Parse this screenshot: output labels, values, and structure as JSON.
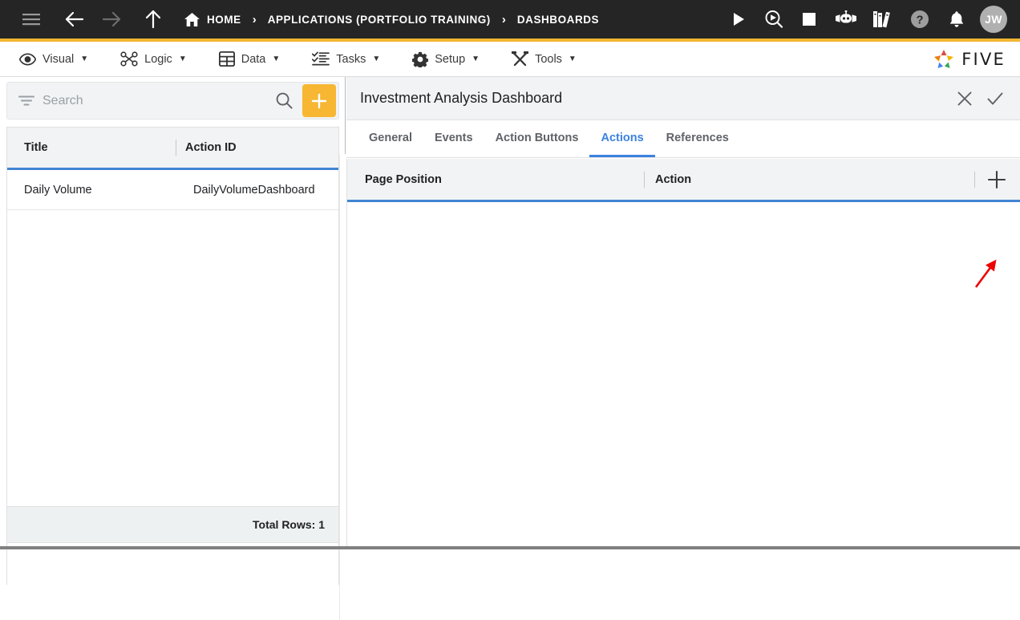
{
  "topbar": {
    "nav_icons": [
      {
        "name": "hamburger-menu-icon",
        "label": "Menu"
      },
      {
        "name": "back-arrow-icon",
        "label": "Back"
      },
      {
        "name": "forward-arrow-icon",
        "label": "Forward"
      },
      {
        "name": "up-arrow-icon",
        "label": "Up"
      }
    ],
    "breadcrumbs": [
      {
        "label": "HOME",
        "icon": "home-icon"
      },
      {
        "label": "APPLICATIONS (PORTFOLIO TRAINING)",
        "icon": ""
      },
      {
        "label": "DASHBOARDS",
        "icon": ""
      }
    ],
    "separator": "›",
    "right_icons": [
      {
        "name": "run-play-icon",
        "label": "Run"
      },
      {
        "name": "debug-search-play-icon",
        "label": "Debug"
      },
      {
        "name": "stop-square-icon",
        "label": "Stop"
      },
      {
        "name": "chat-bot-icon",
        "label": "Assistant"
      },
      {
        "name": "books-library-icon",
        "label": "Documentation"
      },
      {
        "name": "help-question-icon",
        "label": "Help"
      },
      {
        "name": "notification-bell-icon",
        "label": "Notifications"
      }
    ],
    "avatar_initials": "JW",
    "accent_bar_color": "#f2b632",
    "background_color": "#252525"
  },
  "menubar": {
    "items": [
      {
        "label": "Visual",
        "icon": "eye-icon",
        "caret": "▼"
      },
      {
        "label": "Logic",
        "icon": "logic-nodes-icon",
        "caret": "▼"
      },
      {
        "label": "Data",
        "icon": "table-grid-icon",
        "caret": "▼"
      },
      {
        "label": "Tasks",
        "icon": "checklist-icon",
        "caret": "▼"
      },
      {
        "label": "Setup",
        "icon": "gear-icon",
        "caret": "▼"
      },
      {
        "label": "Tools",
        "icon": "tools-wrench-icon",
        "caret": "▼"
      }
    ],
    "brand": {
      "name": "five-logo",
      "wordmark": "FIVE"
    }
  },
  "left_panel": {
    "search": {
      "placeholder": "Search",
      "value": ""
    },
    "filter_icon": "filter-icon",
    "search_icon": "search-icon",
    "add_button": {
      "name": "add-record-button",
      "glyph": "+",
      "color": "#f7b733"
    },
    "grid": {
      "columns": [
        "Title",
        "Action ID"
      ],
      "rows": [
        {
          "Title": "Daily Volume",
          "Action ID": "DailyVolumeDashboard"
        }
      ]
    },
    "footer": {
      "total_rows_label": "Total Rows: 1"
    }
  },
  "right_panel": {
    "title": "Investment Analysis Dashboard",
    "header_actions": [
      {
        "name": "close-icon",
        "label": "Close",
        "glyph": "✕"
      },
      {
        "name": "confirm-check-icon",
        "label": "Save",
        "glyph": "✓"
      }
    ],
    "tabs": [
      {
        "label": "General",
        "active": false
      },
      {
        "label": "Events",
        "active": false
      },
      {
        "label": "Action Buttons",
        "active": false
      },
      {
        "label": "Actions",
        "active": true
      },
      {
        "label": "References",
        "active": false
      }
    ],
    "active_tab_color": "#3b82e0",
    "grid": {
      "columns": [
        "Page Position",
        "Action"
      ],
      "rows": [],
      "add_button": {
        "name": "add-action-row-button",
        "glyph": "+"
      }
    }
  },
  "annotation": {
    "name": "red-arrow-annotation",
    "color": "#ee0000",
    "points_to": "add-action-row-button"
  }
}
